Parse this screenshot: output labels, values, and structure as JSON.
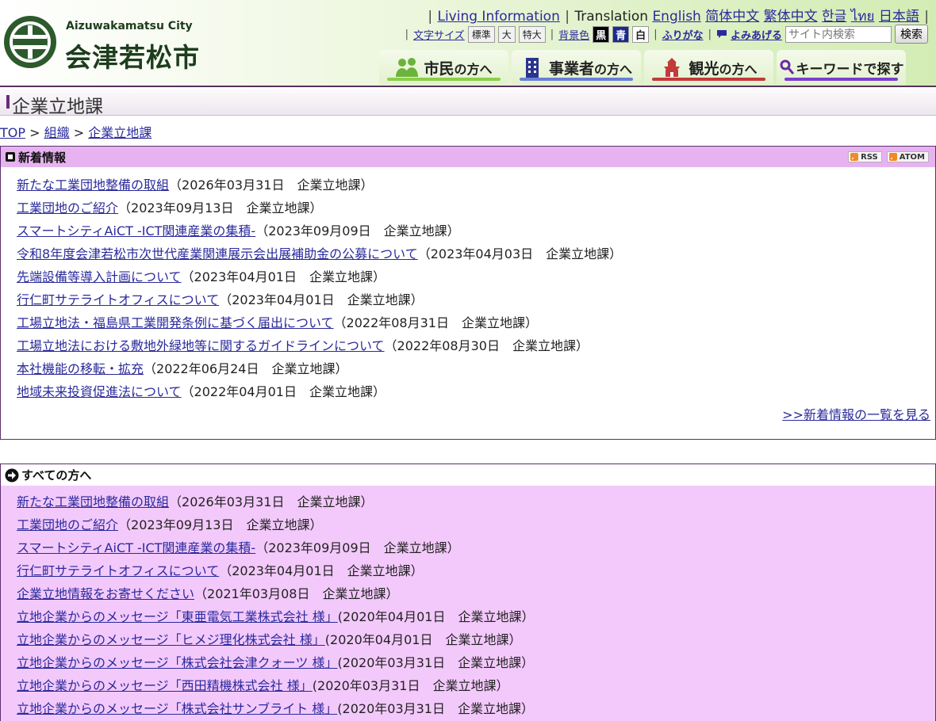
{
  "header": {
    "logo_en": "Aizuwakamatsu City",
    "logo_ja": "会津若松市",
    "lang": {
      "living_info": "Living Information",
      "translation": "Translation",
      "english": "English",
      "zh_hans": "简体中文",
      "zh_hant": "繁体中文",
      "korean": "한글",
      "thai": "ไทย",
      "japanese": "日本語"
    },
    "util": {
      "font_size_label": "文字サイズ",
      "font_standard": "標準",
      "font_large": "大",
      "font_xlarge": "特大",
      "bg_label": "背景色",
      "bg_black": "黒",
      "bg_blue": "青",
      "bg_white": "白",
      "furigana": "ふりがな",
      "read_aloud": "よみあげる",
      "search_placeholder": "サイト内検索",
      "search_button": "検索"
    },
    "nav": {
      "citizens_a": "市民",
      "citizens_b": "の方へ",
      "business_a": "事業者",
      "business_b": "の方へ",
      "tourism_a": "観光",
      "tourism_b": "の方へ",
      "keyword": "キーワードで探す"
    }
  },
  "page_title": "企業立地課",
  "breadcrumb": {
    "top": "TOP",
    "sep1": " > ",
    "org": "組織",
    "sep2": " > ",
    "current": "企業立地課"
  },
  "news": {
    "heading": "新着情報",
    "rss": "RSS",
    "atom": "ATOM",
    "items": [
      {
        "title": "新たな工業団地整備の取組",
        "meta": "（2026年03月31日　企業立地課）"
      },
      {
        "title": "工業団地のご紹介",
        "meta": "（2023年09月13日　企業立地課）"
      },
      {
        "title": "スマートシティAiCT -ICT関連産業の集積-",
        "meta": "（2023年09月09日　企業立地課）"
      },
      {
        "title": "令和8年度会津若松市次世代産業関連展示会出展補助金の公募について",
        "meta": "（2023年04月03日　企業立地課）"
      },
      {
        "title": "先端設備等導入計画について",
        "meta": "（2023年04月01日　企業立地課）"
      },
      {
        "title": "行仁町サテライトオフィスについて",
        "meta": "（2023年04月01日　企業立地課）"
      },
      {
        "title": "工場立地法・福島県工業開発条例に基づく届出について",
        "meta": "（2022年08月31日　企業立地課）"
      },
      {
        "title": "工場立地法における敷地外緑地等に関するガイドラインについて",
        "meta": "（2022年08月30日　企業立地課）"
      },
      {
        "title": "本社機能の移転・拡充",
        "meta": "（2022年06月24日　企業立地課）"
      },
      {
        "title": "地域未来投資促進法について",
        "meta": "（2022年04月01日　企業立地課）"
      }
    ],
    "more": ">>新着情報の一覧を見る"
  },
  "all": {
    "heading": "すべての方へ",
    "items": [
      {
        "title": "新たな工業団地整備の取組",
        "meta": "（2026年03月31日　企業立地課）"
      },
      {
        "title": "工業団地のご紹介",
        "meta": "（2023年09月13日　企業立地課）"
      },
      {
        "title": "スマートシティAiCT -ICT関連産業の集積-",
        "meta": "（2023年09月09日　企業立地課）"
      },
      {
        "title": "行仁町サテライトオフィスについて",
        "meta": "（2023年04月01日　企業立地課）"
      },
      {
        "title": "企業立地情報をお寄せください",
        "meta": "（2021年03月08日　企業立地課）"
      },
      {
        "title": "立地企業からのメッセージ「東亜電気工業株式会社 様」",
        "meta": "(2020年04月01日　企業立地課）"
      },
      {
        "title": "立地企業からのメッセージ「ヒメジ理化株式会社 様」",
        "meta": "(2020年04月01日　企業立地課）"
      },
      {
        "title": "立地企業からのメッセージ「株式会社会津クォーツ 様」",
        "meta": "(2020年03月31日　企業立地課）"
      },
      {
        "title": "立地企業からのメッセージ「西田精機株式会社 様」",
        "meta": "(2020年03月31日　企業立地課）"
      },
      {
        "title": "立地企業からのメッセージ「株式会社サンブライト 様」",
        "meta": "(2020年03月31日　企業立地課）"
      }
    ]
  },
  "colors": {
    "header_accent": "#55335a",
    "news_head": "#e6b3f0",
    "all_body": "#f3c9fb",
    "nav_green": "#8ccf4a",
    "nav_blue": "#6a7fd9",
    "nav_red": "#c23a3a",
    "nav_purple": "#7a3ed0"
  },
  "icons": {
    "logo": "city-emblem",
    "citizens": "people-icon",
    "business": "building-icon",
    "tourism": "castle-icon",
    "keyword": "search-icon",
    "read_aloud": "speech-icon",
    "news": "square-bullet-icon",
    "all": "arrow-circle-icon"
  }
}
